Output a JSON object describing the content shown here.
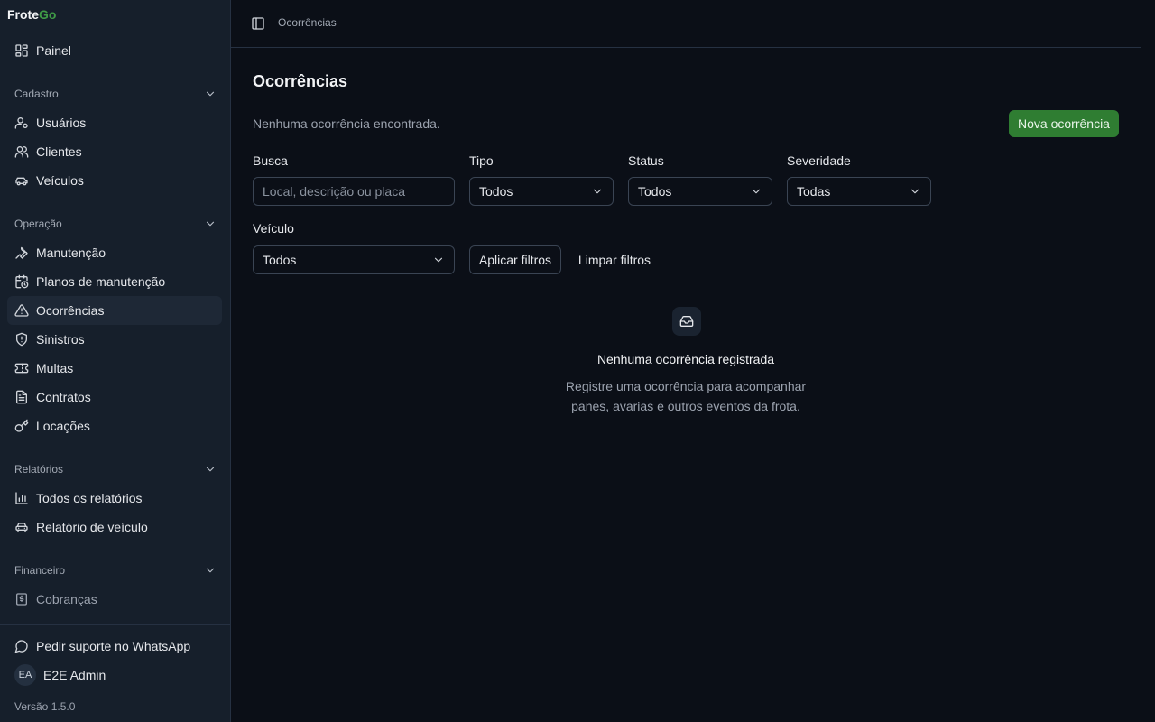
{
  "brand": {
    "part1": "Frote",
    "part2": "Go"
  },
  "sidebar": {
    "painel": "Painel",
    "groups": {
      "cadastro": "Cadastro",
      "operacao": "Operação",
      "relatorios": "Relatórios",
      "financeiro": "Financeiro"
    },
    "items": {
      "usuarios": "Usuários",
      "clientes": "Clientes",
      "veiculos": "Veículos",
      "manutencao": "Manutenção",
      "planos": "Planos de manutenção",
      "ocorrencias": "Ocorrências",
      "sinistros": "Sinistros",
      "multas": "Multas",
      "contratos": "Contratos",
      "locacoes": "Locações",
      "todos_relatorios": "Todos os relatórios",
      "relatorio_veiculo": "Relatório de veículo",
      "cobrancas": "Cobranças"
    },
    "support": "Pedir suporte no WhatsApp",
    "user": {
      "initials": "EA",
      "name": "E2E Admin"
    },
    "version": "Versão 1.5.0"
  },
  "header": {
    "breadcrumb": "Ocorrências"
  },
  "main": {
    "title": "Ocorrências",
    "subtitle": "Nenhuma ocorrência encontrada.",
    "new_button": "Nova ocorrência",
    "filters": {
      "busca_label": "Busca",
      "busca_placeholder": "Local, descrição ou placa",
      "tipo_label": "Tipo",
      "tipo_value": "Todos",
      "status_label": "Status",
      "status_value": "Todos",
      "severidade_label": "Severidade",
      "severidade_value": "Todas",
      "veiculo_label": "Veículo",
      "veiculo_value": "Todos",
      "apply": "Aplicar filtros",
      "clear": "Limpar filtros"
    },
    "empty": {
      "title": "Nenhuma ocorrência registrada",
      "line1": "Registre uma ocorrência para acompanhar",
      "line2": "panes, avarias e outros eventos da frota."
    }
  }
}
